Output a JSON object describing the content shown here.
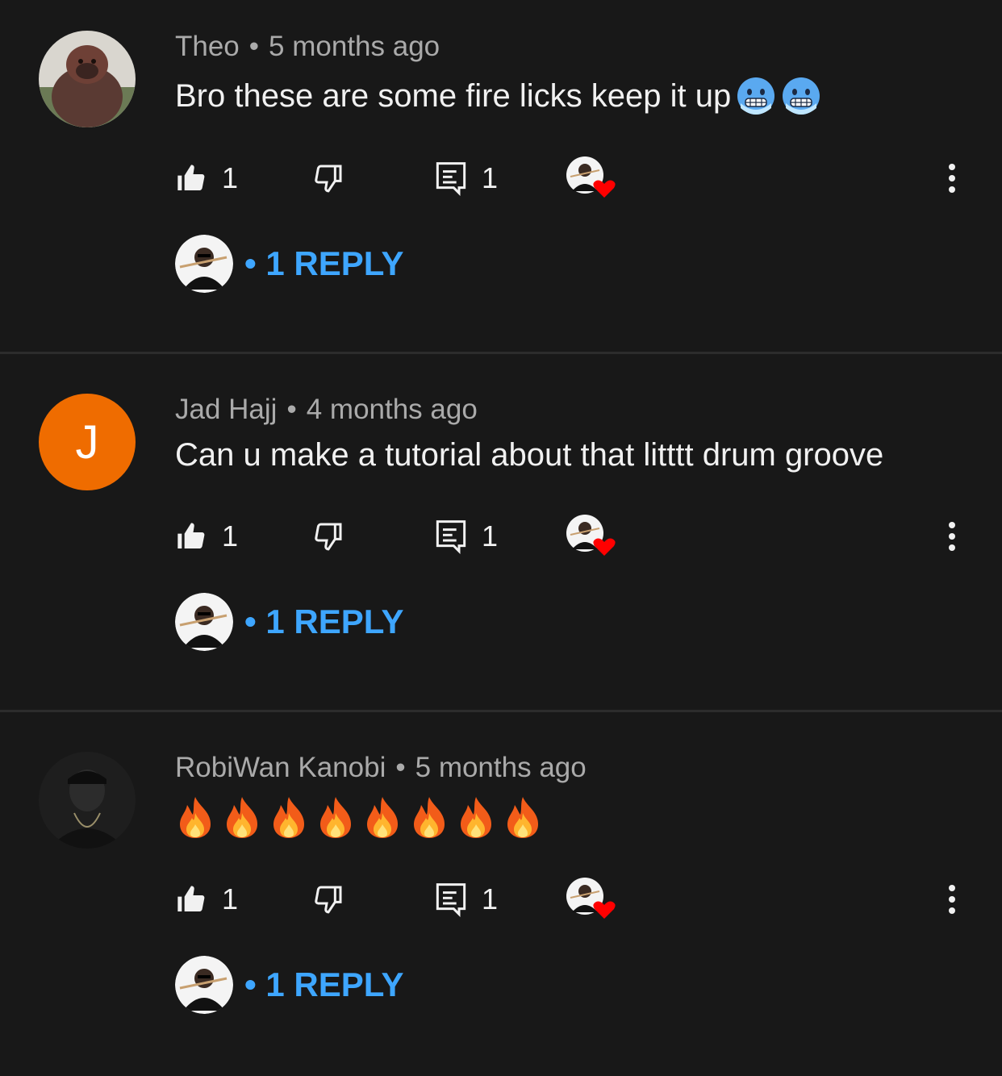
{
  "comments": [
    {
      "author": "Theo",
      "separator": "•",
      "time": "5 months ago",
      "text": "Bro these are some fire licks keep it up",
      "text_emojis": [
        "cold-face-emoji",
        "cold-face-emoji"
      ],
      "avatar": "orangutan-photo",
      "likes": "1",
      "reply_count": "1",
      "replies_label": "• 1 REPLY"
    },
    {
      "author": "Jad Hajj",
      "separator": "•",
      "time": "4 months ago",
      "text": "Can u make a tutorial about that litttt drum groove",
      "avatar_letter": "J",
      "avatar_color": "#ef6c00",
      "likes": "1",
      "reply_count": "1",
      "replies_label": "• 1 REPLY"
    },
    {
      "author": "RobiWan Kanobi",
      "separator": "•",
      "time": "5 months ago",
      "text": "",
      "text_emojis": [
        "fire-emoji",
        "fire-emoji",
        "fire-emoji",
        "fire-emoji",
        "fire-emoji",
        "fire-emoji",
        "fire-emoji",
        "fire-emoji"
      ],
      "avatar": "dark-portrait-photo",
      "likes": "1",
      "reply_count": "1",
      "replies_label": "• 1 REPLY"
    }
  ],
  "colors": {
    "background": "#181818",
    "reply_link": "#3ea6ff",
    "meta_text": "#aaaaaa",
    "heart": "#ff0000"
  }
}
